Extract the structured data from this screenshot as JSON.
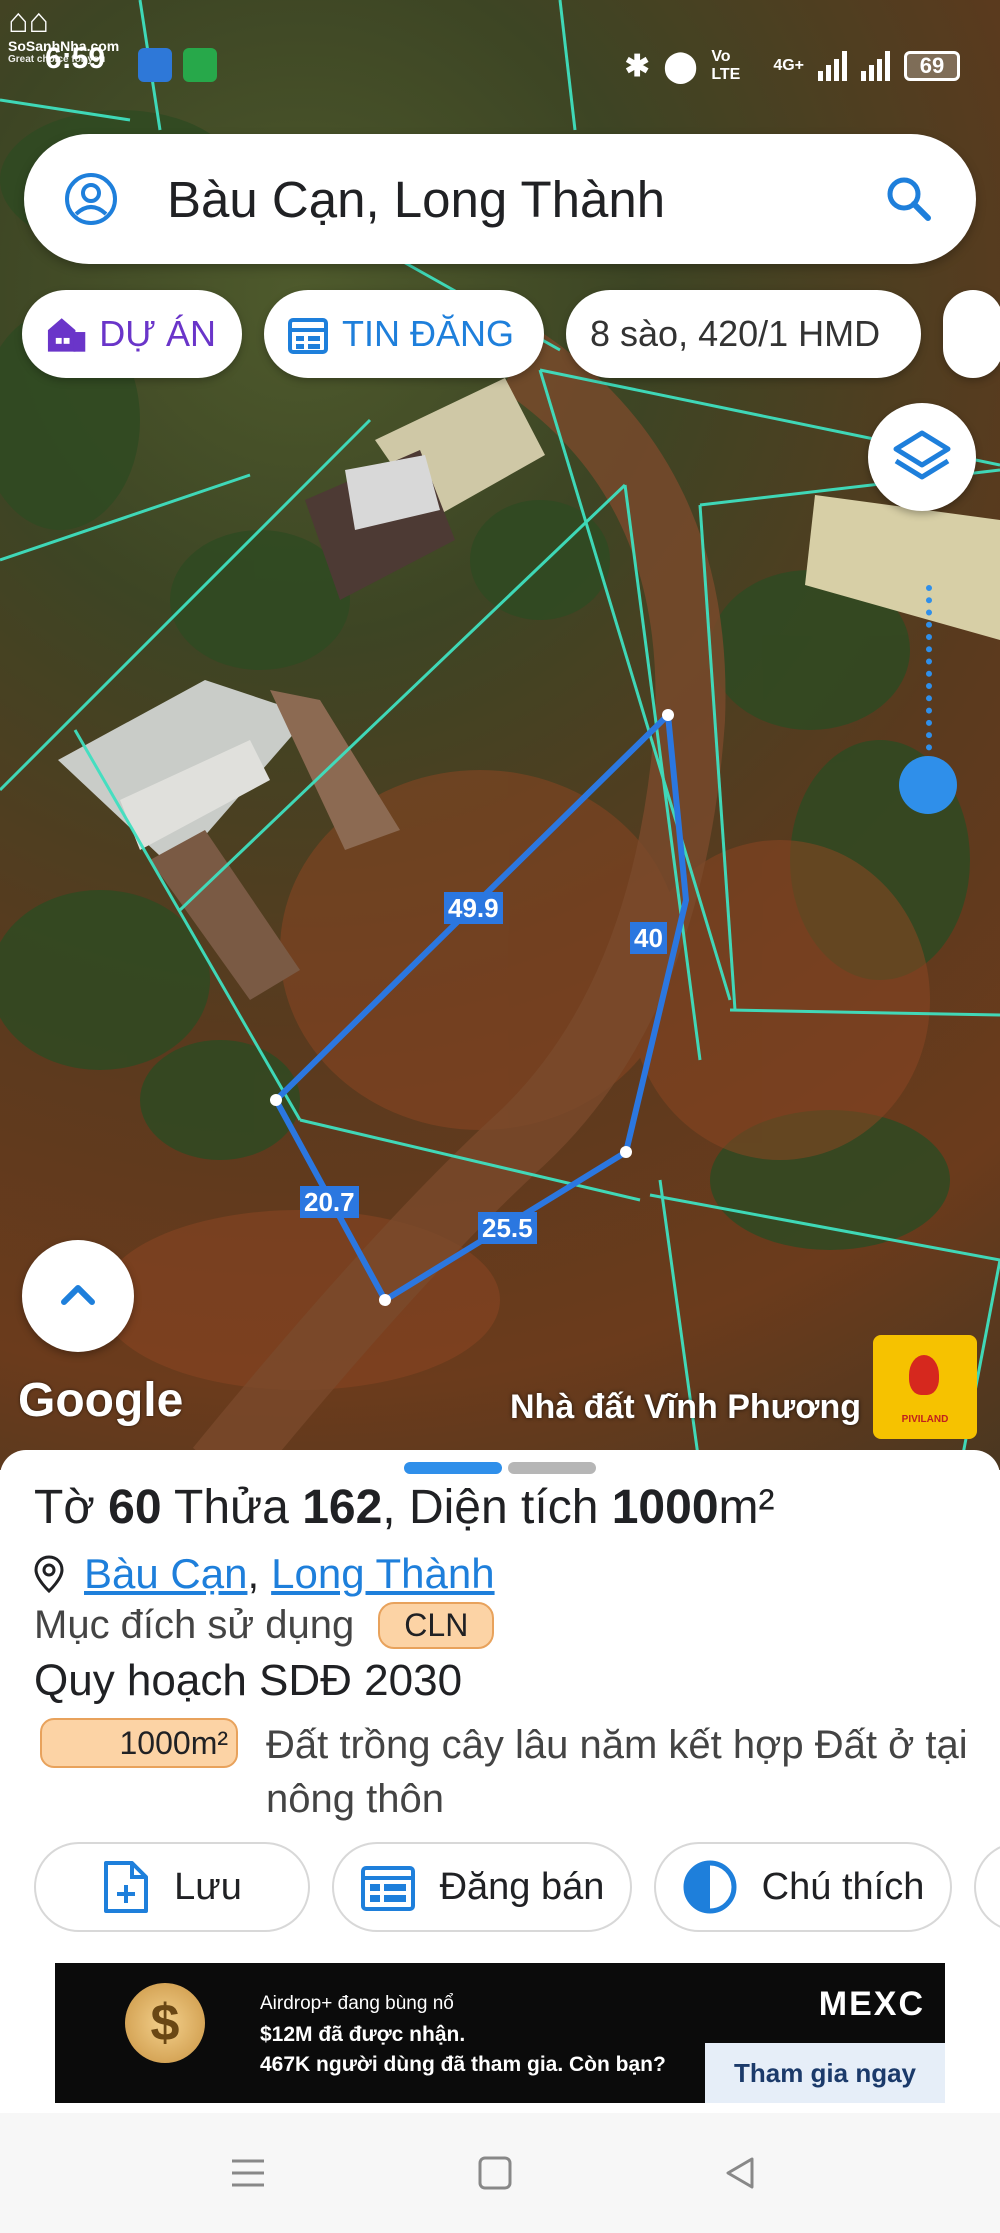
{
  "status_bar": {
    "time": "6:59",
    "network_label": "Vo LTE",
    "network_gen": "4G+",
    "battery": "69"
  },
  "logo": {
    "name": "SoSanhNha.com",
    "tagline": "Great choice for you"
  },
  "search": {
    "value": "Bàu Cạn, Long Thành"
  },
  "chips": {
    "du_an": "DỰ ÁN",
    "tin_dang": "TIN ĐĂNG",
    "filter": "8 sào, 420/1 HMD"
  },
  "map": {
    "edges": [
      "49.9",
      "40",
      "20.7",
      "25.5"
    ],
    "google_label": "Google",
    "watermark": "Nhà đất Vĩnh Phương",
    "brand_logo_text": "PIVILAND"
  },
  "parcel": {
    "to_label": "Tờ",
    "to_value": "60",
    "thua_label": "Thửa",
    "thua_value": "162",
    "area_label": "Diện tích",
    "area_value": "1000",
    "area_unit": "m²",
    "location_commune": "Bàu Cạn",
    "location_sep": ",",
    "location_district": "Long Thành",
    "purpose_label": "Mục đích sử dụng",
    "purpose_code": "CLN",
    "plan_title": "Quy hoạch SDĐ 2030",
    "plan_area": "1000m²",
    "plan_desc": "Đất trồng cây lâu năm kết hợp Đất ở tại nông thôn"
  },
  "actions": {
    "save": "Lưu",
    "sell": "Đăng bán",
    "legend": "Chú thích"
  },
  "ad": {
    "line1": "Airdrop+ đang bùng nổ",
    "line2": "$12M đã được nhận.",
    "line3": "467K người dùng đã tham gia. Còn bạn?",
    "brand": "MEXC",
    "cta": "Tham gia ngay"
  },
  "colors": {
    "accent_blue": "#2f8fea",
    "parcel_line": "#2b77e0",
    "boundary_line": "#3fe0c0",
    "badge_fill": "#fcd3a5",
    "project_purple": "#6a35c9"
  }
}
